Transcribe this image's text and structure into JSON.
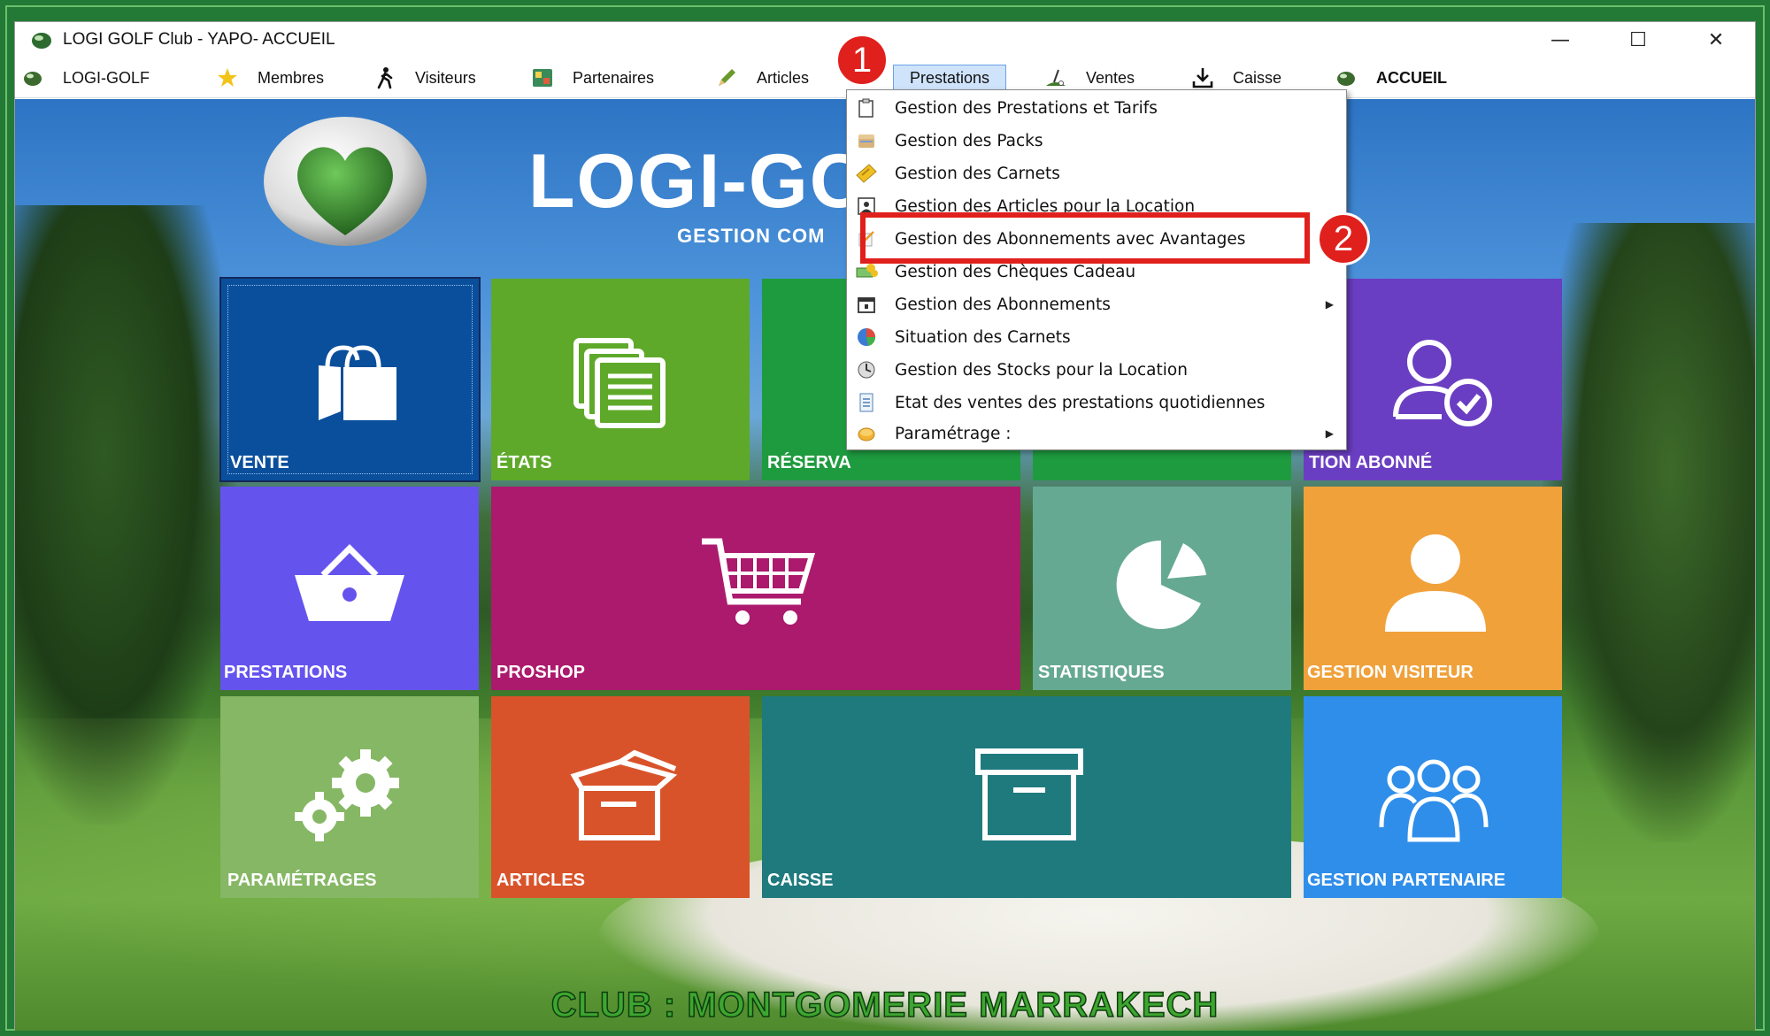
{
  "window": {
    "title": "LOGI GOLF Club - YAPO- ACCUEIL",
    "controls": [
      "—",
      "☐",
      "✕"
    ]
  },
  "menubar": {
    "items": [
      {
        "label": "LOGI-GOLF",
        "icon": "golf-ball-icon"
      },
      {
        "label": "Membres",
        "icon": "star-icon"
      },
      {
        "label": "Visiteurs",
        "icon": "walking-person-icon"
      },
      {
        "label": "Partenaires",
        "icon": "partners-icon"
      },
      {
        "label": "Articles",
        "icon": "pencil-icon"
      },
      {
        "label": "Prestations",
        "icon": "",
        "active": true
      },
      {
        "label": "Ventes",
        "icon": "golf-club-icon"
      },
      {
        "label": "Caisse",
        "icon": "download-icon"
      },
      {
        "label": "ACCUEIL",
        "icon": "golf-ball-icon"
      }
    ]
  },
  "dropdown": {
    "items": [
      {
        "label": "Gestion des Prestations et Tarifs",
        "icon": "clipboard-icon",
        "submenu": false
      },
      {
        "label": "Gestion des Packs",
        "icon": "pack-icon",
        "submenu": false
      },
      {
        "label": "Gestion des Carnets",
        "icon": "ticket-icon",
        "submenu": false
      },
      {
        "label": "Gestion des Articles pour la Location",
        "icon": "rental-icon",
        "submenu": false
      },
      {
        "label": "Gestion des Abonnements avec Avantages",
        "icon": "note-icon",
        "submenu": false
      },
      {
        "label": "Gestion des Chèques Cadeau",
        "icon": "money-icon",
        "submenu": false
      },
      {
        "label": "Gestion des Abonnements",
        "icon": "calendar-icon",
        "submenu": true
      },
      {
        "label": "Situation des Carnets",
        "icon": "pie-chart-icon",
        "submenu": false
      },
      {
        "label": "Gestion des Stocks pour la Location",
        "icon": "stock-icon",
        "submenu": false
      },
      {
        "label": "Etat des ventes des prestations quotidiennes",
        "icon": "document-icon",
        "submenu": false
      },
      {
        "label": "Paramétrage :",
        "icon": "settings-coin-icon",
        "submenu": true
      }
    ]
  },
  "brand": {
    "title": "LOGI-GO",
    "subtitle": "GESTION COM"
  },
  "tiles": {
    "vente": "VENTE",
    "etats": "ÉTATS",
    "reservation": "RÉSERVA",
    "abonne": "TION ABONNÉ",
    "prestations": "PRESTATIONS",
    "proshop": "PROSHOP",
    "statistiques": "STATISTIQUES",
    "visiteur": "GESTION VISITEUR",
    "parametrages": "PARAMÉTRAGES",
    "articles": "ARTICLES",
    "caisse": "CAISSE",
    "partenaire": "GESTION PARTENAIRE"
  },
  "colors": {
    "vente": "#0a4f9c",
    "etats": "#5fa92a",
    "reservation": "#1e9b3f",
    "abonne": "#6a3ec2",
    "prestations": "#6553ee",
    "proshop": "#ac1a6d",
    "statistiques": "#66a992",
    "visiteur": "#f0a13a",
    "parametrages": "#86b765",
    "articles": "#d9532a",
    "caisse": "#1f7a7e",
    "partenaire": "#2f8eea",
    "highlight": "#e0201c"
  },
  "club": {
    "name": "CLUB : MONTGOMERIE MARRAKECH"
  },
  "callouts": {
    "one": "1",
    "two": "2"
  }
}
